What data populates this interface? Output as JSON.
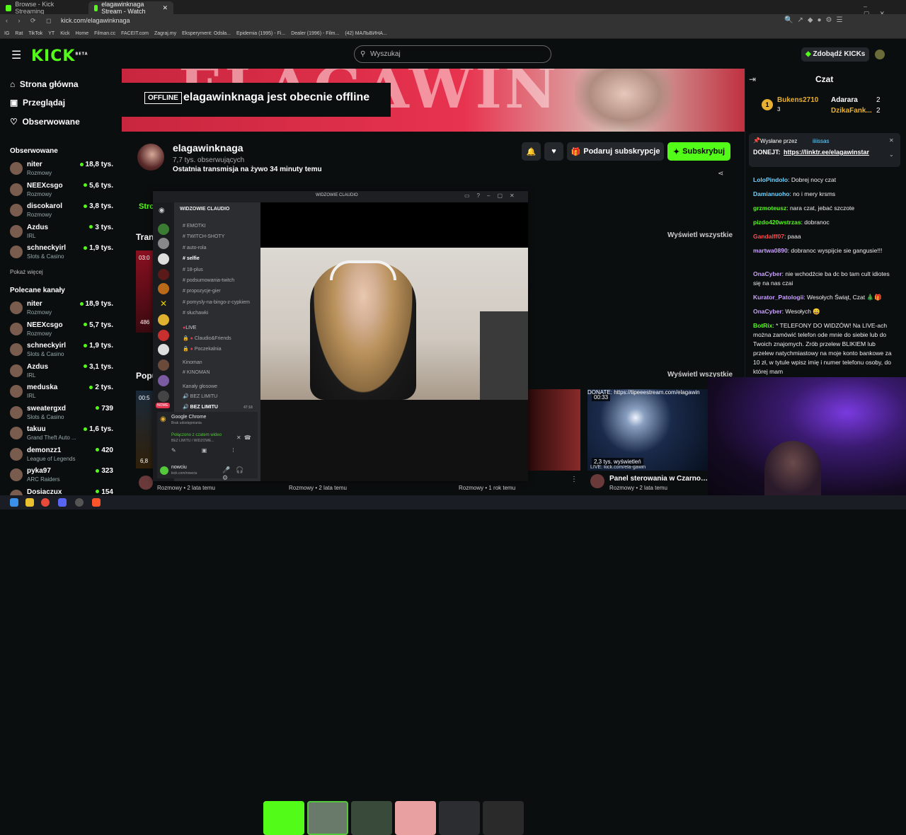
{
  "browser": {
    "tabs": [
      "Browse - Kick Streaming",
      "elagawinknaga Stream - Watch"
    ],
    "url": "kick.com/elagawinknaga",
    "bookmarks": [
      "IG",
      "Rat",
      "TikTok",
      "YT",
      "Kick",
      "Home",
      "Filman.cc",
      "FACEIT.com",
      "Zagraj.my",
      "Eksperyment: Odsła...",
      "Epidemia (1995) - Fi...",
      "Dealer (1996) - Film...",
      "(42) МАЛЬВИНА..."
    ]
  },
  "nav": {
    "logo": "KICK",
    "logo_sup": "BETA",
    "search_placeholder": "Wyszukaj",
    "get_kicks": "Zdobądź KICKs"
  },
  "sidebar": {
    "main": [
      {
        "label": "Strona główna",
        "icon": "home-icon"
      },
      {
        "label": "Przeglądaj",
        "icon": "browse-icon"
      },
      {
        "label": "Obserwowane",
        "icon": "heart-icon"
      }
    ],
    "followed_title": "Obserwowane",
    "followed": [
      {
        "name": "niter",
        "category": "Rozmowy",
        "viewers": "18,8 tys."
      },
      {
        "name": "NEEXcsgo",
        "category": "Rozmowy",
        "viewers": "5,6 tys."
      },
      {
        "name": "discokarol",
        "category": "Rozmowy",
        "viewers": "3,8 tys."
      },
      {
        "name": "Azdus",
        "category": "IRL",
        "viewers": "3 tys."
      },
      {
        "name": "schneckyirl",
        "category": "Slots & Casino",
        "viewers": "1,9 tys."
      }
    ],
    "show_more": "Pokaż więcej",
    "recommended_title": "Polecane kanały",
    "recommended": [
      {
        "name": "niter",
        "category": "Rozmowy",
        "viewers": "18,9 tys."
      },
      {
        "name": "NEEXcsgo",
        "category": "Rozmowy",
        "viewers": "5,7 tys."
      },
      {
        "name": "schneckyirl",
        "category": "Slots & Casino",
        "viewers": "1,9 tys."
      },
      {
        "name": "Azdus",
        "category": "IRL",
        "viewers": "3,1 tys."
      },
      {
        "name": "meduska",
        "category": "IRL",
        "viewers": "2 tys."
      },
      {
        "name": "sweatergxd",
        "category": "Slots & Casino",
        "viewers": "739"
      },
      {
        "name": "takuu",
        "category": "Grand Theft Auto ...",
        "viewers": "1,6 tys."
      },
      {
        "name": "demonzz1",
        "category": "League of Legends",
        "viewers": "420"
      },
      {
        "name": "pyka97",
        "category": "ARC Raiders",
        "viewers": "323"
      },
      {
        "name": "Dosiaczux",
        "category": "",
        "viewers": "154"
      }
    ]
  },
  "banner": {
    "badge": "OFFLINE",
    "text": "elagawinknaga jest obecnie offline"
  },
  "channel": {
    "name": "elagawinknaga",
    "followers": "7,7 tys. obserwujących",
    "last_stream": "Ostatnia transmisja na żywo 34 minuty temu",
    "gift_label": "Podaruj subskrypcje",
    "subscribe_label": "Subskrybuj",
    "tab_partial": "Stro",
    "section1_partial": "Tran",
    "section2_partial": "Popu",
    "view_all": "Wyświetl wszystkie"
  },
  "videos": [
    {
      "meta": "Rozmowy • 2 lata temu"
    },
    {
      "meta": "Rozmowy • 2 lata temu"
    },
    {
      "meta": "Rozmowy • 1 rok temu"
    },
    {
      "title": "Panel sterowania w Czarnobyl...",
      "meta": "Rozmowy • 2 lata temu",
      "duration": "00:33",
      "views": "2,3 tys. wyświetleń",
      "donate": "DONATE: https://tipeeestream.com/elagawin",
      "live_text": "LIVE: kick.com/ela-gawin"
    }
  ],
  "thumb_labels": {
    "t1": "03:0",
    "t2": "486",
    "t3": "00:5",
    "t4": "6,8"
  },
  "chat": {
    "title": "Czat",
    "leaderboard": [
      {
        "rank": "1",
        "name": "Bukens2710",
        "count": "3"
      },
      {
        "name": "Adarara",
        "count": "2"
      },
      {
        "name": "DzikaFank...",
        "count": "2"
      }
    ],
    "pinned_by_label": "Wysłane przez",
    "pinned_by": "iiiissas",
    "pinned_text": "DONEJT: ",
    "pinned_link": "https://linktr.ee/elagawinstar",
    "messages": [
      {
        "user": "LoloPindolo",
        "color": "#6fd3ff",
        "text": ": Dobrej nocy czat"
      },
      {
        "user": "Damianuoho",
        "color": "#6fd3ff",
        "text": ": no i mery krsms"
      },
      {
        "user": "grzmoteusz",
        "color": "#53fc18",
        "text": ": nara czat, jebać szczote"
      },
      {
        "user": "pizdo420wstrzas",
        "color": "#53fc18",
        "text": ": dobranoc"
      },
      {
        "user": "Gandalff07",
        "color": "#ff4d4d",
        "text": ": paaa"
      },
      {
        "user": "martwa0890",
        "color": "#c9a0ff",
        "text": ": dobranoc wyspijcie sie gangusie!!!"
      },
      {
        "user": "OnaCyber",
        "color": "#c9a0ff",
        "text": ": nie wchodźcie ba dc bo tam cult idiotes się na nas czai"
      },
      {
        "user": "Kurator_Patologii",
        "color": "#c9a0ff",
        "text": ": Wesołych Świąt, Czat 🎄🎁"
      },
      {
        "user": "OnaCyber",
        "color": "#c9a0ff",
        "text": ": Wesołych 😄"
      },
      {
        "user": "BotRix",
        "color": "#53fc18",
        "text": ": * TELEFONY DO WIDZÓW! Na LIVE-ach można zamówić telefon ode mnie do siebie lub do Twoich znajomych. Zrób przelew BLIKIEM lub przelew natychmiastowy na moje konto bankowe za 10 zł, w tytule wpisz imię i numer telefonu osoby, do której mam"
      }
    ]
  },
  "discord": {
    "window_title": "WIDZOWIE CLAUDIO",
    "server_name": "WIDZOWIE CLAUDIO",
    "channels": [
      "EMOTKI",
      "TWITCH-SHOTY",
      "auto-rola",
      "selfie",
      "18-plus",
      "podsumowania-twitch",
      "propozycje-gier",
      "pomysly-na-bingo-z-cypkiem",
      "słuchawki"
    ],
    "live_header": "LIVE",
    "live_channels": [
      "Claudio&Friends",
      "Poczekalnia"
    ],
    "kinoman_header": "Kinoman",
    "kinoman_channel": "KINOMAN",
    "voice_header": "Kanały głosowe",
    "voice_channel": "BEZ LIMITU",
    "active_voice": "BEZ LIMITU",
    "active_time": "47:18",
    "chrome_title": "Google Chrome",
    "chrome_sub": "Brak udostępniania",
    "connected": "Połączono z czatem wideo",
    "connected_sub": "BEZ LIMITU / WIDZOWE...",
    "user_name": "nowciu",
    "user_sub": "kick.com/nowciu",
    "badge_live": "NOWE"
  },
  "taskbar": {
    "icons": [
      "windows-icon",
      "folder-icon",
      "chrome-icon",
      "discord-icon",
      "obs-icon",
      "brave-icon"
    ]
  },
  "colors": {
    "accent": "#53fc18",
    "bg": "#0b0e0f",
    "banner": "#e8334f"
  }
}
